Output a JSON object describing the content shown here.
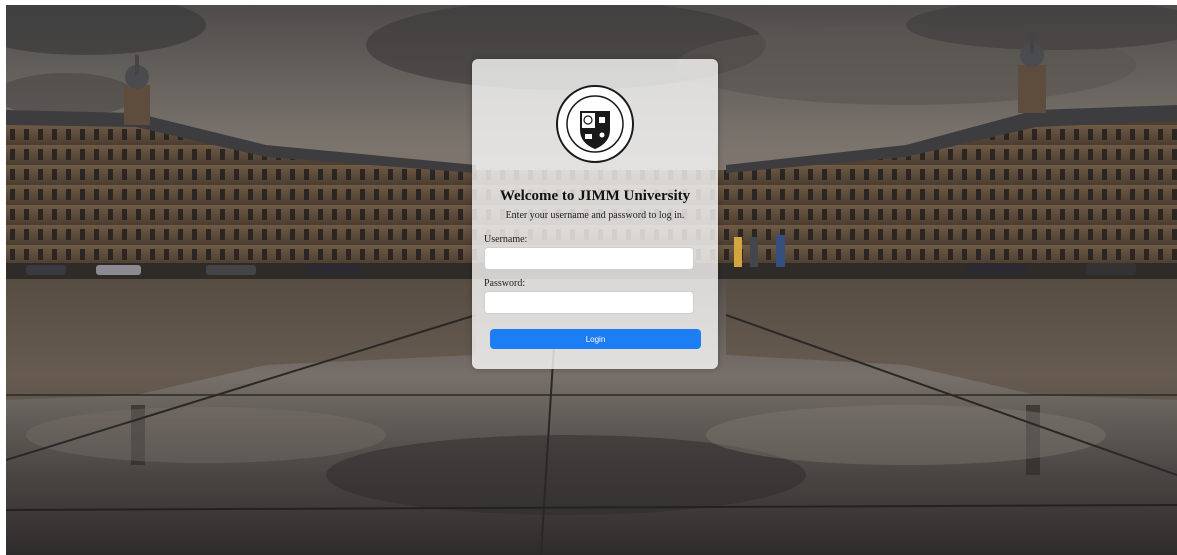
{
  "background": {
    "description_icon": "palace-waterfront-background"
  },
  "login": {
    "logo_text_top": "JIMM UNIVERSITY",
    "logo_text_bottom": "KNOWLEDGE IS POWER",
    "title": "Welcome to JIMM University",
    "subtitle": "Enter your username and password to log in.",
    "username_label": "Username:",
    "username_value": "",
    "password_label": "Password:",
    "password_value": "",
    "login_button": "Login"
  },
  "colors": {
    "button": "#1d7df5",
    "card": "rgba(255,255,255,0.78)"
  }
}
